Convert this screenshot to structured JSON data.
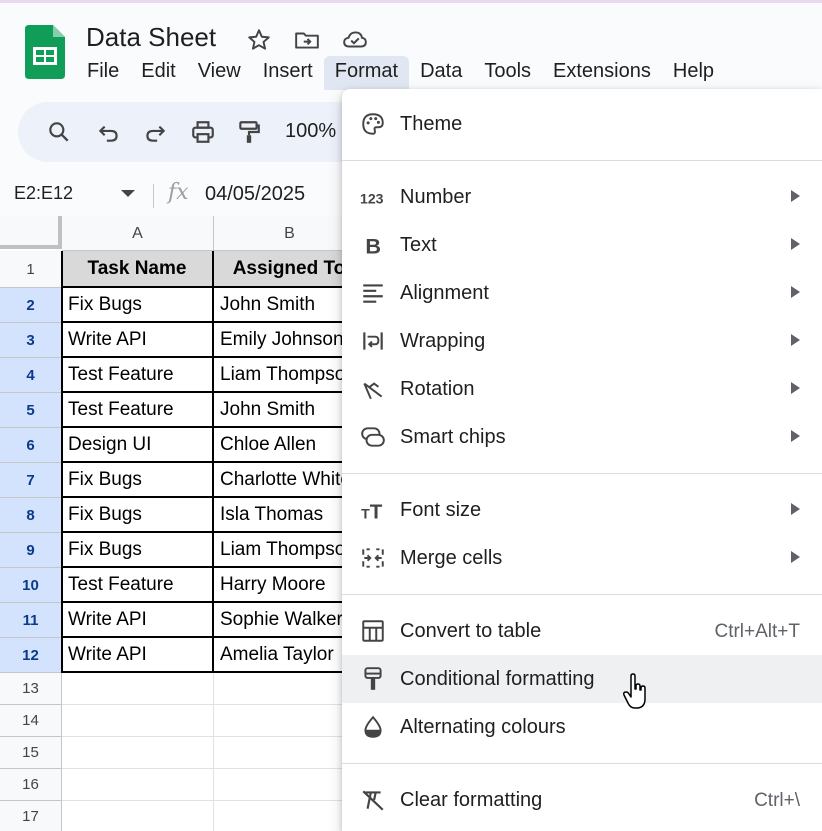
{
  "app": {
    "doc_title": "Data Sheet",
    "menus": [
      "File",
      "Edit",
      "View",
      "Insert",
      "Format",
      "Data",
      "Tools",
      "Extensions",
      "Help"
    ],
    "active_menu": "Format"
  },
  "toolbar": {
    "zoom": "100%"
  },
  "formula_bar": {
    "name_box": "E2:E12",
    "fx": "fx",
    "value": "04/05/2025"
  },
  "sheet": {
    "columns": [
      "A",
      "B"
    ],
    "headers": [
      "Task Name",
      "Assigned To"
    ],
    "rows": [
      {
        "num": "1"
      },
      {
        "num": "2",
        "task": "Fix Bugs",
        "assignee": "John Smith"
      },
      {
        "num": "3",
        "task": "Write API",
        "assignee": "Emily Johnson"
      },
      {
        "num": "4",
        "task": "Test Feature",
        "assignee": "Liam Thompson"
      },
      {
        "num": "5",
        "task": "Test Feature",
        "assignee": "John Smith"
      },
      {
        "num": "6",
        "task": "Design UI",
        "assignee": "Chloe Allen"
      },
      {
        "num": "7",
        "task": "Fix Bugs",
        "assignee": "Charlotte White"
      },
      {
        "num": "8",
        "task": "Fix Bugs",
        "assignee": "Isla Thomas"
      },
      {
        "num": "9",
        "task": "Fix Bugs",
        "assignee": "Liam Thompson"
      },
      {
        "num": "10",
        "task": "Test Feature",
        "assignee": "Harry Moore"
      },
      {
        "num": "11",
        "task": "Write API",
        "assignee": "Sophie Walker"
      },
      {
        "num": "12",
        "task": "Write API",
        "assignee": "Amelia Taylor"
      },
      {
        "num": "13"
      },
      {
        "num": "14"
      },
      {
        "num": "15"
      },
      {
        "num": "16"
      },
      {
        "num": "17"
      }
    ]
  },
  "format_menu": {
    "items": [
      {
        "label": "Theme",
        "icon": "palette-icon"
      },
      {
        "label": "Number",
        "icon": "number-icon",
        "submenu": true
      },
      {
        "label": "Text",
        "icon": "bold-icon",
        "submenu": true
      },
      {
        "label": "Alignment",
        "icon": "align-icon",
        "submenu": true
      },
      {
        "label": "Wrapping",
        "icon": "wrap-icon",
        "submenu": true
      },
      {
        "label": "Rotation",
        "icon": "rotation-icon",
        "submenu": true
      },
      {
        "label": "Smart chips",
        "icon": "chips-icon",
        "submenu": true
      },
      {
        "label": "Font size",
        "icon": "font-size-icon",
        "submenu": true
      },
      {
        "label": "Merge cells",
        "icon": "merge-icon",
        "submenu": true
      },
      {
        "label": "Convert to table",
        "icon": "table-icon",
        "shortcut": "Ctrl+Alt+T"
      },
      {
        "label": "Conditional formatting",
        "icon": "paint-roller-icon",
        "hovered": true
      },
      {
        "label": "Alternating colours",
        "icon": "drop-icon"
      },
      {
        "label": "Clear formatting",
        "icon": "clear-format-icon",
        "shortcut": "Ctrl+\\"
      }
    ]
  },
  "colors": {
    "sheets_green": "#0f9d58",
    "selection": "#d3e3fd",
    "header_fill": "#d9d9d9"
  }
}
